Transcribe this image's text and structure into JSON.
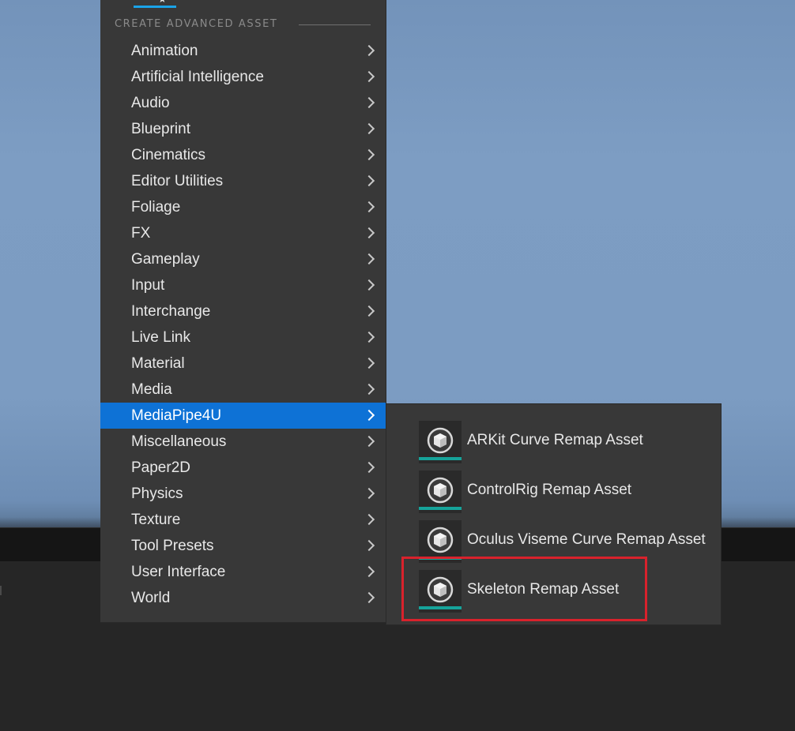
{
  "menu": {
    "section_header": "CREATE ADVANCED ASSET",
    "items": [
      {
        "label": "Animation"
      },
      {
        "label": "Artificial Intelligence"
      },
      {
        "label": "Audio"
      },
      {
        "label": "Blueprint"
      },
      {
        "label": "Cinematics"
      },
      {
        "label": "Editor Utilities"
      },
      {
        "label": "Foliage"
      },
      {
        "label": "FX"
      },
      {
        "label": "Gameplay"
      },
      {
        "label": "Input"
      },
      {
        "label": "Interchange"
      },
      {
        "label": "Live Link"
      },
      {
        "label": "Material"
      },
      {
        "label": "Media"
      },
      {
        "label": "MediaPipe4U",
        "selected": true
      },
      {
        "label": "Miscellaneous"
      },
      {
        "label": "Paper2D"
      },
      {
        "label": "Physics"
      },
      {
        "label": "Texture"
      },
      {
        "label": "Tool Presets"
      },
      {
        "label": "User Interface"
      },
      {
        "label": "World"
      }
    ],
    "selected_color": "#0e72d6"
  },
  "submenu": {
    "items": [
      {
        "label": "ARKit Curve Remap Asset",
        "icon": "asset-cube-icon"
      },
      {
        "label": "ControlRig Remap Asset",
        "icon": "asset-cube-icon"
      },
      {
        "label": "Oculus Viseme Curve Remap Asset",
        "icon": "asset-cube-icon"
      },
      {
        "label": "Skeleton Remap Asset",
        "icon": "asset-cube-icon",
        "highlighted": true
      }
    ],
    "accent_color": "#16a39a",
    "highlight_color": "#d9222c"
  }
}
